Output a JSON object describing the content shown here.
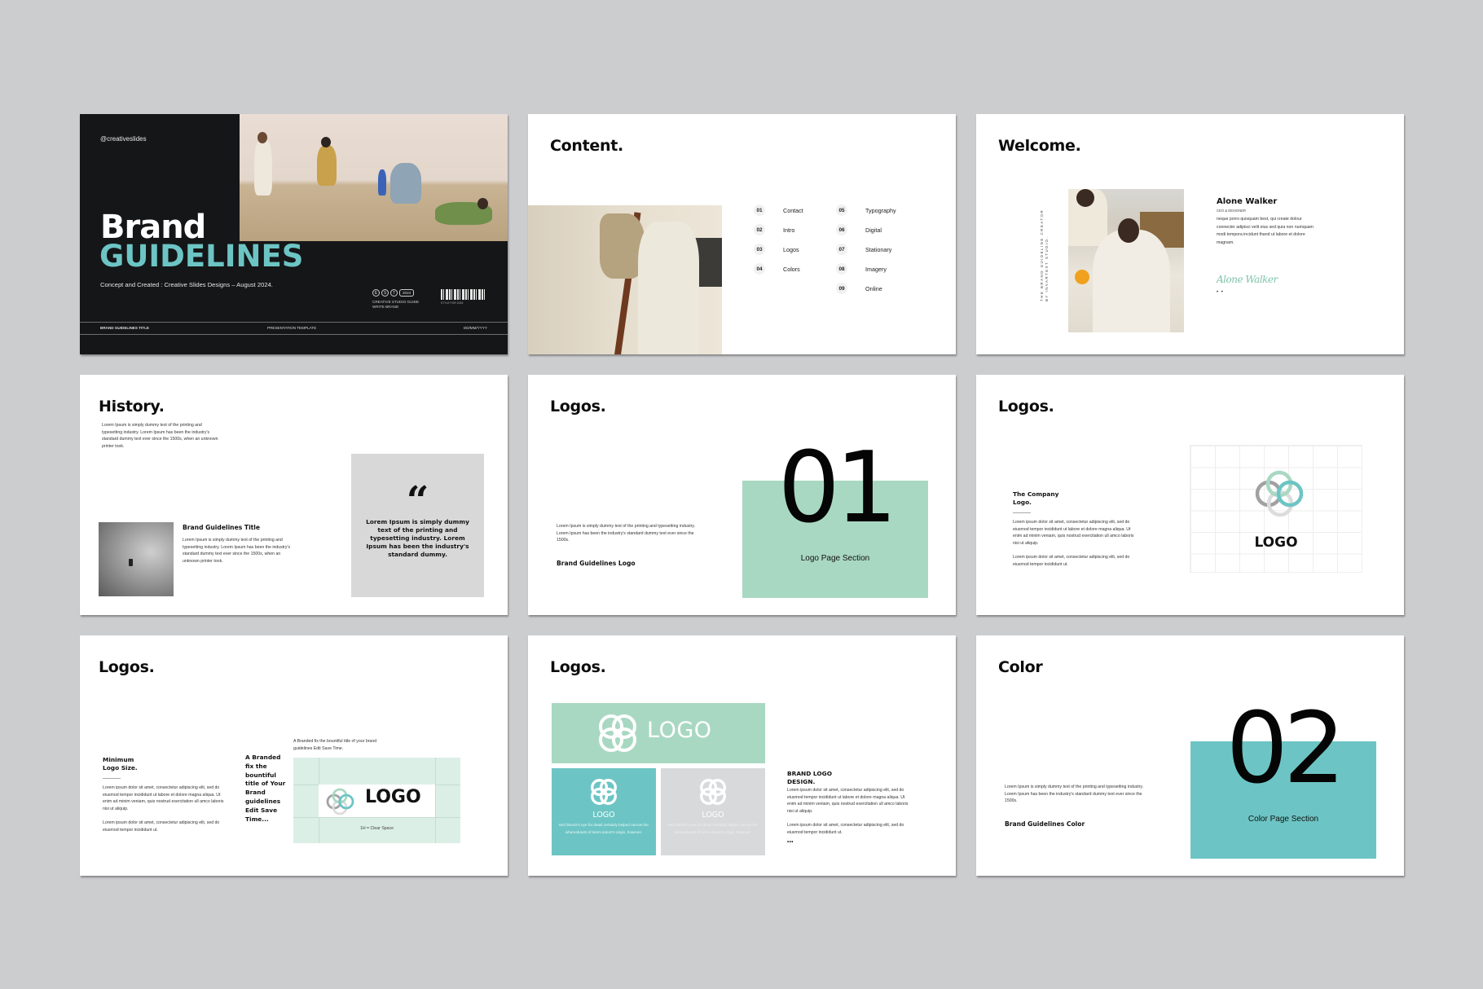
{
  "colors": {
    "background": "#cccdcf",
    "dark": "#151618",
    "teal": "#6cc5c4",
    "mint": "#a9d8c2",
    "light_grey": "#d8d8d8",
    "logo_grey": "#a1a1a4"
  },
  "slides": [
    {
      "id": "cover",
      "handle": "@creativeslides",
      "title_line1": "Brand",
      "title_line2": "GUIDELINES",
      "concept": "Concept and Created : Creative Slides Designs – August 2024.",
      "badges": [
        "E",
        "S",
        "T"
      ],
      "year": "2024",
      "studio_line": "CREATIVE STUDIO GUIDE WRITE BRAND",
      "barcode_label": "STYLE FOR 2026",
      "footer": {
        "left": "BRAND GUIDELINES TITLE",
        "center": "PRESENTATION TEMPLATE",
        "right": "DD/MM/YYYY"
      }
    },
    {
      "id": "content",
      "title": "Content.",
      "items": [
        {
          "num": "01",
          "label": "Contact"
        },
        {
          "num": "02",
          "label": "Intro"
        },
        {
          "num": "03",
          "label": "Logos"
        },
        {
          "num": "04",
          "label": "Colors"
        },
        {
          "num": "05",
          "label": "Typography"
        },
        {
          "num": "06",
          "label": "Digital"
        },
        {
          "num": "07",
          "label": "Stationary"
        },
        {
          "num": "08",
          "label": "Imagery"
        },
        {
          "num": "09",
          "label": "Online"
        }
      ]
    },
    {
      "id": "welcome",
      "title": "Welcome.",
      "vertical_line1": "THE BRAND GUIDELINE CREATOR",
      "vertical_line2": "BY INVARTEXT STUDIO.",
      "name": "Alone Walker",
      "role": "CEO & DESIGNER",
      "bio": "neque porro quisquam best, qui create dolour connecter adipisci velit eius sed quia non numquam modi tempora incidunt thand ut labore et dolore magnam.",
      "signature": "Alone Walker",
      "dots": "• •"
    },
    {
      "id": "history",
      "title": "History.",
      "intro": "Lorem Ipsum is simply dummy text of the printing and typesetting industry. Lorem Ipsum has been the industry's standard dummy text ever since the 1500s, when an unknown printer took.",
      "sub_title": "Brand Guidelines Title",
      "sub_text": "Lorem Ipsum is simply dummy text of the printing and typesetting industry. Lorem Ipsum has been the industry's standard dummy text ever since the 1500s, when an unknown printer took.",
      "quote_mark": "“",
      "quote": "Lorem Ipsum is simply dummy text of the printing and typesetting industry. Lorem Ipsum has been the industry's standard dummy."
    },
    {
      "id": "logos-section",
      "title": "Logos.",
      "text": "Lorem Ipsum is simply dummy text of the printing and typesetting industry. Lorem Ipsum has been the industry's standard dummy text ever since the 1500s.",
      "sub": "Brand Guidelines Logo",
      "number": "01",
      "section_label": "Logo Page Section"
    },
    {
      "id": "logos-company",
      "title": "Logos.",
      "heading_line1": "The Company",
      "heading_line2": "Logo.",
      "p1": "Lorem ipsum dolor sit amet, consectetur adipiscing elit, sed do eiusmod tempor incididunt ut labore et dolore magna aliqua. Ut enim ad minim veniam, quis nostrud exercitation ull amco laboris nisi ut aliquip.",
      "p2": "Lorem ipsum dolor sit amet, consectetur adipiscing elit, sed do eiusmod tempor incididunt ut.",
      "logo_word": "LOGO"
    },
    {
      "id": "logos-min-size",
      "title": "Logos.",
      "heading_line1": "Minimum",
      "heading_line2": "Logo Size.",
      "p1": "Lorem ipsum dolor sit amet, consectetur adipiscing elit, sed do eiusmod tempor incididunt ut labore et dolore magna aliqua. Ut enim ad minim veniam, quis nostrud exercitation ull amco laboris nisi ut aliquip.",
      "p2": "Lorem ipsum dolor sit amet, consectetur adipiscing elit, sed do eiusmod tempor incididunt ut.",
      "middle_text": "A Branded fix the bountiful title of Your Brand guidelines Edit Save Time...",
      "caption": "A Branded fix the bountiful title of your brand guidelines Edit Save Time.",
      "logo_word": "LOGO",
      "clear_space": "1H = Clear Space"
    },
    {
      "id": "logos-design",
      "title": "Logos.",
      "big_logo_word": "LOGO",
      "card_teal_word": "LOGO",
      "card_teal_text": "McClintock's eye for detail certainly helped narrow the whereabouts of lorem ipsum's origin, however.",
      "card_grey_word": "LOGO",
      "card_grey_text": "McClintock's eye for detail certainly helped narrow the whereabouts of lorem ipsum's origin, however.",
      "heading_line1": "BRAND LOGO",
      "heading_line2": "DESIGN.",
      "p1": "Lorem ipsum dolor sit amet, consectetur adipiscing elit, sed do eiusmod tempor incididunt ut labore et dolore magna aliqua. Ut enim ad minim veniam, quis nostrud exercitation ull amco laboris nisi ut aliquip.",
      "p2": "Lorem ipsum dolor sit amet, consectetur adipiscing elit, sed do eiusmod tempor incididunt ut.",
      "dots": "•••"
    },
    {
      "id": "color-section",
      "title": "Color",
      "text": "Lorem Ipsum is simply dummy text of the printing and typesetting industry. Lorem Ipsum has been the industry's standard dummy text ever since the 1500s.",
      "sub": "Brand Guidelines Color",
      "number": "02",
      "section_label": "Color Page Section"
    }
  ]
}
